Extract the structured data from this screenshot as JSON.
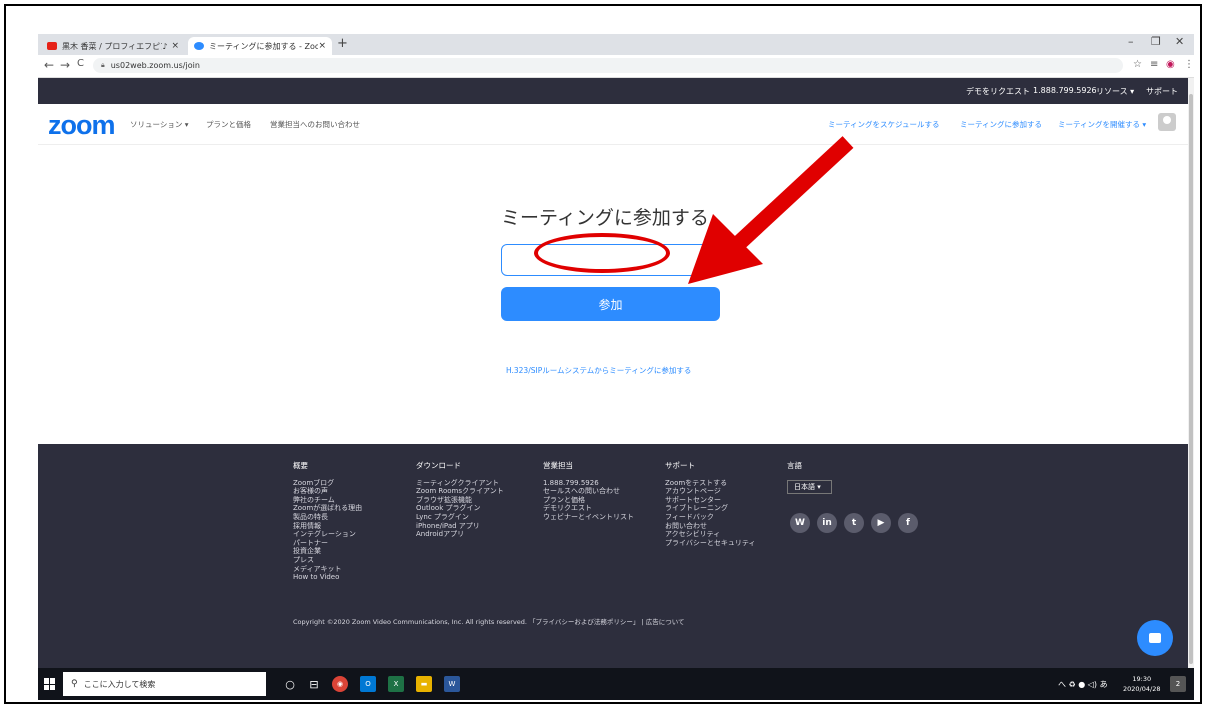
{
  "browser": {
    "tabs": [
      {
        "title": "黒木 香菜 / プロフィエフピア /",
        "favicon_color": "#e62117",
        "sound_icon": "♪",
        "close": "×"
      },
      {
        "title": "ミーティングに参加する - Zoom",
        "favicon_color": "#2d8cff",
        "close": "×"
      }
    ],
    "new_tab": "+",
    "window_controls": [
      "–",
      "❐",
      "✕"
    ],
    "url": "us02web.zoom.us/join",
    "nav": {
      "back": "←",
      "forward": "→",
      "reload": "C"
    },
    "ext_icons": [
      "☆",
      "≡",
      "◉",
      "⋮"
    ]
  },
  "zoom_top": {
    "demo_request": "デモをリクエスト",
    "phone": "1.888.799.5926",
    "resources": "リソース ▾",
    "support": "サポート"
  },
  "zoom_nav": {
    "logo": "zoom",
    "solutions": "ソリューション ▾",
    "plans": "プランと価格",
    "sales": "営業担当へのお問い合わせ",
    "schedule": "ミーティングをスケジュールする",
    "join": "ミーティングに参加する",
    "host": "ミーティングを開催する ▾"
  },
  "join": {
    "title": "ミーティングに参加する",
    "input_value": "",
    "button": "参加",
    "h323_link": "H.323/SIPルームシステムからミーティングに参加する"
  },
  "annotations": {
    "color": "#e00000"
  },
  "footer": {
    "columns": [
      {
        "head": "概要",
        "items": [
          "Zoomブログ",
          "お客様の声",
          "弊社のチーム",
          "Zoomが選ばれる理由",
          "製品の特長",
          "採用情報",
          "インテグレーション",
          "パートナー",
          "投資企業",
          "プレス",
          "メディアキット",
          "How to Video"
        ]
      },
      {
        "head": "ダウンロード",
        "items": [
          "ミーティングクライアント",
          "Zoom Roomsクライアント",
          "ブラウザ拡張機能",
          "Outlook プラグイン",
          "Lync プラグイン",
          "iPhone/iPad アプリ",
          "Androidアプリ"
        ]
      },
      {
        "head": "営業担当",
        "items": [
          "1.888.799.5926",
          "セールスへの問い合わせ",
          "プランと価格",
          "デモリクエスト",
          "ウェビナーとイベントリスト"
        ]
      },
      {
        "head": "サポート",
        "items": [
          "Zoomをテストする",
          "アカウントページ",
          "サポートセンター",
          "ライブトレーニング",
          "フィードバック",
          "お問い合わせ",
          "アクセシビリティ",
          "プライバシーとセキュリティ"
        ]
      },
      {
        "head": "言語",
        "items": []
      }
    ],
    "language": "日本語 ▾",
    "social": [
      "W",
      "in",
      "t",
      "▶",
      "f"
    ],
    "copyright": "Copyright ©2020 Zoom Video Communications, Inc. All rights reserved.  「プライバシーおよび法務ポリシー」 | 広告について"
  },
  "taskbar": {
    "search_placeholder": "ここに入力して検索",
    "search_icon": "⚲",
    "apps": [
      "○",
      "⊟",
      "◉",
      "O",
      "X",
      "▬",
      "W"
    ],
    "tray": "へ ♻ ● ◁) あ",
    "time": "19:30",
    "date": "2020/04/28",
    "notification_count": "2"
  }
}
